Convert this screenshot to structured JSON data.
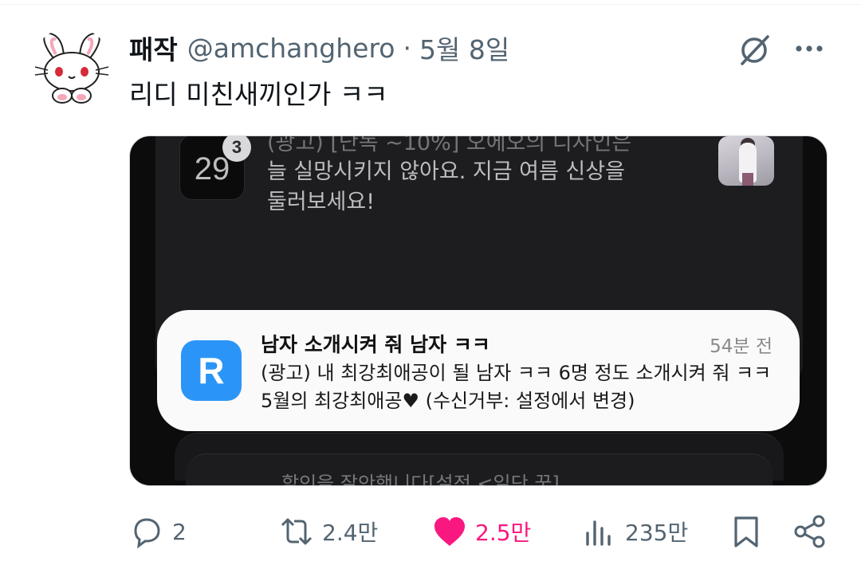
{
  "tweet": {
    "display_name": "패작",
    "handle": "@amchanghero",
    "separator": "·",
    "date": "5월 8일",
    "text": "리디 미친새끼인가 ㅋㅋ"
  },
  "screenshot": {
    "calendar_day": "29",
    "calendar_badge": "3",
    "bg_notification_lines": [
      "(광고) [단독 ~10%] 오에오의 디자인은",
      "늘 실망시키지 않아요. 지금 여름 신상을",
      "둘러보세요!"
    ],
    "notification": {
      "app_icon_letter": "R",
      "title": "남자 소개시켜 줘 남자 ㅋㅋ",
      "time": "54분 전",
      "body": "(광고) 내 최강최애공이 될 남자 ㅋㅋ 6명 정도 소개시켜 줘 ㅋㅋ 5월의 최강최애공♥ (수신거부: 설정에서 변경)",
      "app_color": "#2b95f7"
    },
    "bg_bottom_text": "할인을 잘안했니다[설정 <일단 꿈]"
  },
  "actions": {
    "reply_count": "2",
    "retweet_count": "2.4만",
    "like_count": "2.5만",
    "views_count": "235만",
    "like_color": "#f91880"
  }
}
